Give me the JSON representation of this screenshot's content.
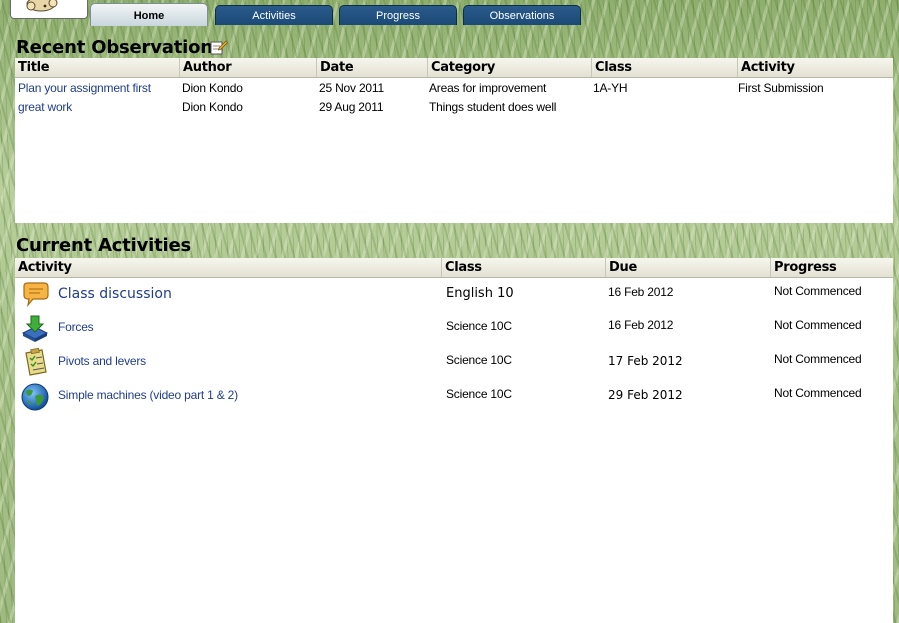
{
  "tabs": [
    {
      "label": "Home",
      "active": true
    },
    {
      "label": "Activities",
      "active": false
    },
    {
      "label": "Progress",
      "active": false
    },
    {
      "label": "Observations",
      "active": false
    }
  ],
  "observations": {
    "title": "Recent Observations",
    "columns": [
      "Title",
      "Author",
      "Date",
      "Category",
      "Class",
      "Activity"
    ],
    "rows": [
      {
        "title": "Plan your assignment first",
        "author": "Dion Kondo",
        "date": "25 Nov 2011",
        "category": "Areas for improvement",
        "class": "1A-YH",
        "activity": "First Submission"
      },
      {
        "title": "great work",
        "author": "Dion Kondo",
        "date": "29 Aug 2011",
        "category": "Things student does well",
        "class": "",
        "activity": ""
      }
    ]
  },
  "activities": {
    "title": "Current Activities",
    "columns": [
      "Activity",
      "Class",
      "Due",
      "Progress"
    ],
    "rows": [
      {
        "icon": "speech-bubble-icon",
        "activity": "Class discussion",
        "class": "English 10",
        "due": "16 Feb 2012",
        "progress": "Not Commenced"
      },
      {
        "icon": "download-tray-icon",
        "activity": "Forces",
        "class": "Science 10C",
        "due": "16 Feb 2012",
        "progress": "Not Commenced"
      },
      {
        "icon": "clipboard-icon",
        "activity": "Pivots and levers",
        "class": "Science 10C",
        "due": "17 Feb 2012",
        "progress": "Not Commenced"
      },
      {
        "icon": "globe-icon",
        "activity": "Simple machines (video part 1 & 2)",
        "class": "Science 10C",
        "due": "29 Feb 2012",
        "progress": "Not Commenced"
      }
    ]
  },
  "colors": {
    "tab": "#1b4a78",
    "link": "#1f3d8c",
    "header": "#e3e1d3"
  }
}
